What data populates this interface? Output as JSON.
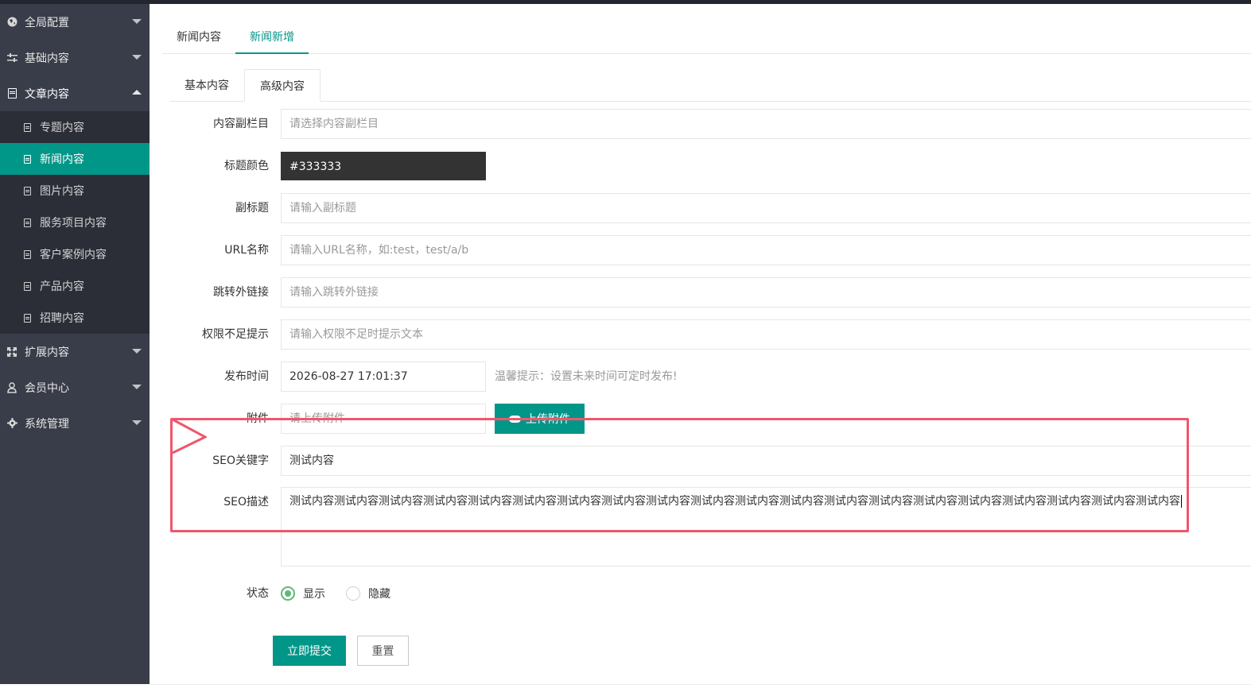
{
  "sidebar": {
    "items": [
      {
        "label": "全局配置",
        "icon": "globe-icon"
      },
      {
        "label": "基础内容",
        "icon": "sliders-icon"
      },
      {
        "label": "文章内容",
        "icon": "document-icon"
      },
      {
        "label": "扩展内容",
        "icon": "expand-icon"
      },
      {
        "label": "会员中心",
        "icon": "user-icon"
      },
      {
        "label": "系统管理",
        "icon": "gear-icon"
      }
    ],
    "sub_items": [
      {
        "label": "专题内容"
      },
      {
        "label": "新闻内容"
      },
      {
        "label": "图片内容"
      },
      {
        "label": "服务项目内容"
      },
      {
        "label": "客户案例内容"
      },
      {
        "label": "产品内容"
      },
      {
        "label": "招聘内容"
      }
    ]
  },
  "main": {
    "top_tabs": [
      {
        "label": "新闻内容"
      },
      {
        "label": "新闻新增"
      }
    ],
    "sub_tabs": [
      {
        "label": "基本内容"
      },
      {
        "label": "高级内容"
      }
    ],
    "form": {
      "sub_column": {
        "label": "内容副栏目",
        "placeholder": "请选择内容副栏目"
      },
      "title_color": {
        "label": "标题颜色",
        "value": "#333333"
      },
      "subtitle": {
        "label": "副标题",
        "placeholder": "请输入副标题"
      },
      "url_name": {
        "label": "URL名称",
        "placeholder": "请输入URL名称，如:test，test/a/b"
      },
      "outlink": {
        "label": "跳转外链接",
        "placeholder": "请输入跳转外链接"
      },
      "gtips": {
        "label": "权限不足提示",
        "placeholder": "请输入权限不足时提示文本"
      },
      "publish_time": {
        "label": "发布时间",
        "value": "2026-08-27 17:01:37",
        "hint": "温馨提示：设置未来时间可定时发布!"
      },
      "attachment": {
        "label": "附件",
        "placeholder": "请上传附件",
        "upload_label": "上传附件"
      },
      "seo_keywords": {
        "label": "SEO关键字",
        "value": "测试内容"
      },
      "seo_description": {
        "label": "SEO描述",
        "value": "测试内容测试内容测试内容测试内容测试内容测试内容测试内容测试内容测试内容测试内容测试内容测试内容测试内容测试内容测试内容测试内容测试内容测试内容测试内容测试内容"
      },
      "status": {
        "label": "状态",
        "options": [
          "显示",
          "隐藏"
        ],
        "selected": "显示"
      }
    },
    "buttons": {
      "submit": "立即提交",
      "reset": "重置"
    }
  },
  "colors": {
    "accent": "#009688",
    "sidebar_bg": "#393d49",
    "highlight": "#f0566c",
    "radio_checked": "#5FB878"
  }
}
